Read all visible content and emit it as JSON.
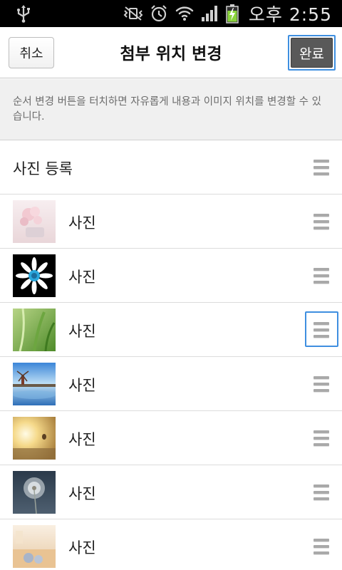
{
  "status_bar": {
    "time": "오후 2:55",
    "icons": [
      "usb-icon",
      "vibrate-mute-icon",
      "alarm-icon",
      "wifi-icon",
      "signal-icon",
      "battery-charging-icon"
    ]
  },
  "header": {
    "cancel_label": "취소",
    "title": "첨부 위치 변경",
    "done_label": "완료"
  },
  "info_text": "순서 변경 버튼을 터치하면 자유롭게 내용과 이미지 위치를 변경할 수 있습니다.",
  "list": {
    "header_label": "사진 등록",
    "items": [
      {
        "label": "사진",
        "thumb": "pink-flowers-photo"
      },
      {
        "label": "사진",
        "thumb": "daisy-photo"
      },
      {
        "label": "사진",
        "thumb": "green-grass-photo"
      },
      {
        "label": "사진",
        "thumb": "windmill-lake-photo"
      },
      {
        "label": "사진",
        "thumb": "sunset-balloon-photo"
      },
      {
        "label": "사진",
        "thumb": "dandelion-photo"
      },
      {
        "label": "사진",
        "thumb": "beach-photo"
      }
    ],
    "focused_handle_index": 2
  },
  "colors": {
    "focus_outline": "#3f8fe0",
    "done_button": "#595959",
    "info_background": "#f0f0f0"
  }
}
